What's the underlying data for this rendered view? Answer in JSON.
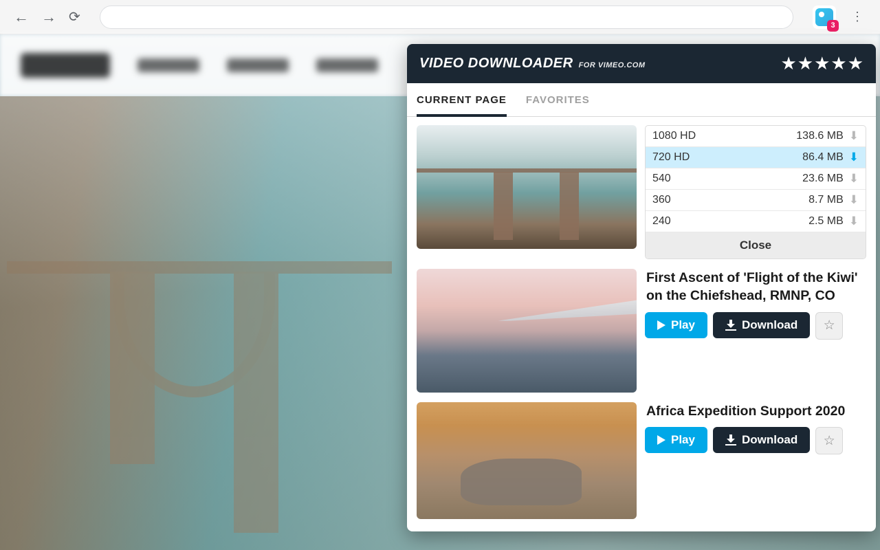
{
  "browser": {
    "badge_count": "3"
  },
  "popup": {
    "title": "VIDEO DOWNLOADER",
    "subtitle": "FOR VIMEO.COM",
    "star_rating": 5
  },
  "tabs": [
    {
      "label": "CURRENT PAGE",
      "active": true
    },
    {
      "label": "FAVORITES",
      "active": false
    }
  ],
  "quality_panel": {
    "options": [
      {
        "label": "1080 HD",
        "size": "138.6 MB",
        "selected": false
      },
      {
        "label": "720 HD",
        "size": "86.4 MB",
        "selected": true
      },
      {
        "label": "540",
        "size": "23.6 MB",
        "selected": false
      },
      {
        "label": "360",
        "size": "8.7 MB",
        "selected": false
      },
      {
        "label": "240",
        "size": "2.5 MB",
        "selected": false
      }
    ],
    "close_label": "Close"
  },
  "videos": [
    {
      "title": "First Ascent of 'Flight of the Kiwi' on the Chiefshead, RMNP, CO"
    },
    {
      "title": "Africa Expedition Support 2020"
    }
  ],
  "buttons": {
    "play": "Play",
    "download": "Download"
  }
}
